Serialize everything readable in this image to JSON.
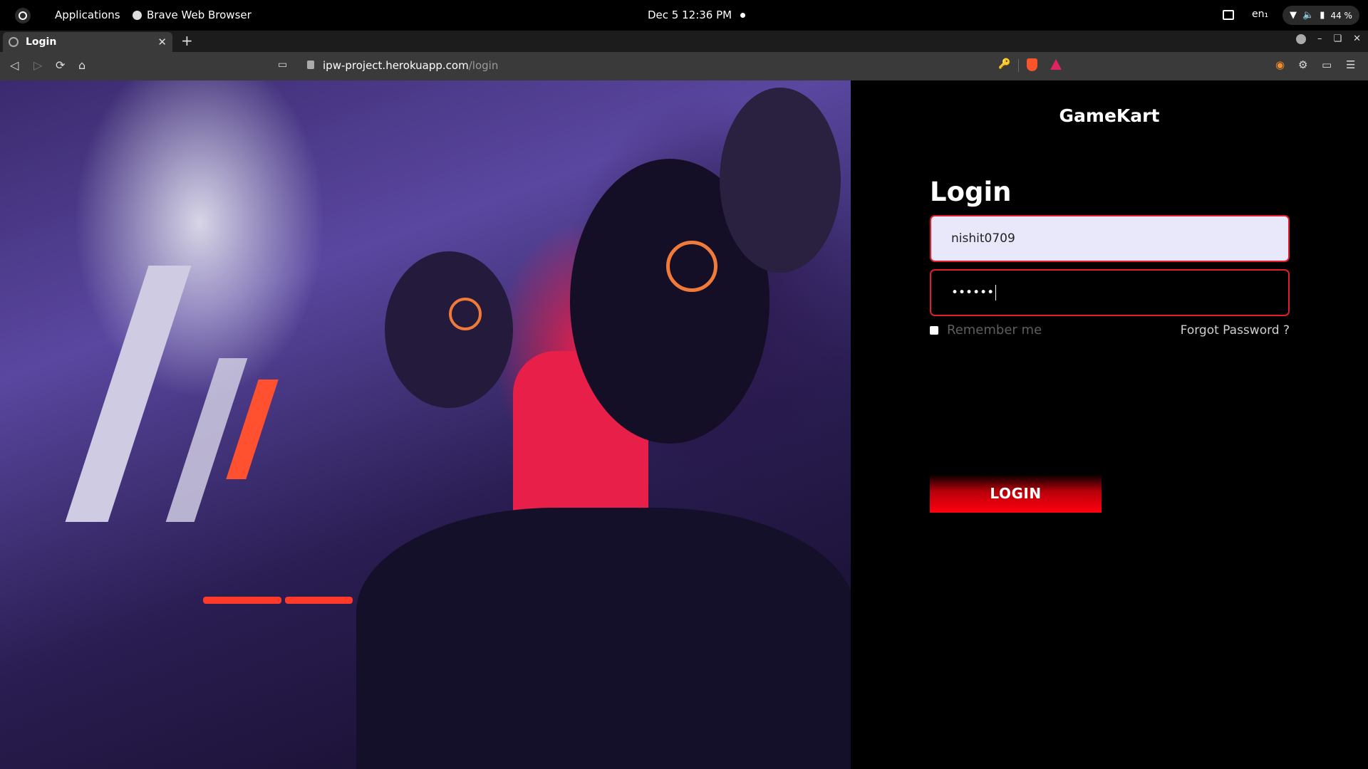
{
  "os_bar": {
    "applications_label": "Applications",
    "focused_app": "Brave Web Browser",
    "clock": "Dec 5  12:36 PM",
    "language": "en₁",
    "battery": "44 %"
  },
  "browser": {
    "tab_title": "Login",
    "url_host": "ipw-project.herokuapp.com",
    "url_path": "/login"
  },
  "page": {
    "brand": "GameKart",
    "heading": "Login",
    "username_value": "nishit0709",
    "password_mask": "••••••",
    "remember_label": "Remember me",
    "remember_checked": false,
    "forgot_label": "Forgot Password ?",
    "login_button": "LOGIN",
    "accent_color": "#e21d2e"
  }
}
